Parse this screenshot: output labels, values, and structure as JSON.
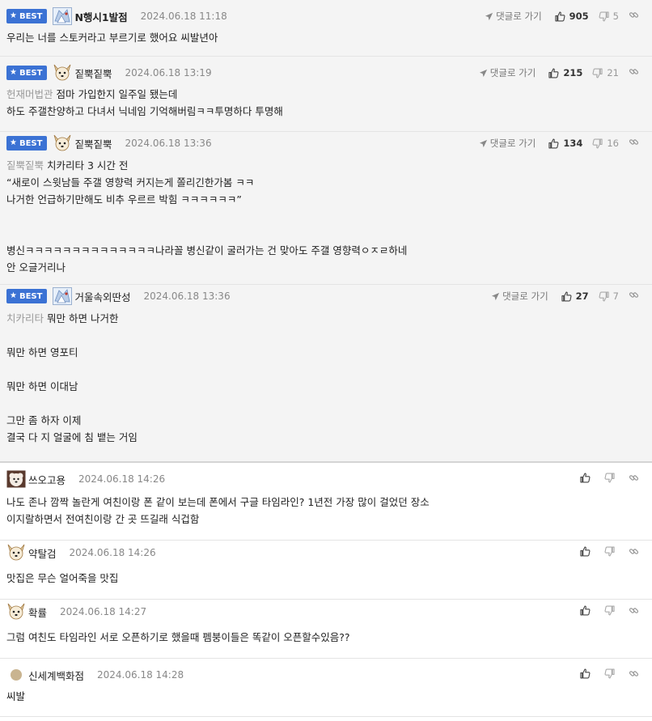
{
  "labels": {
    "best": "BEST",
    "goto_reply": "댓글로 가기"
  },
  "colors": {
    "best_badge": "#3b72d4",
    "best_bg": "#f4f4f4"
  },
  "comments": [
    {
      "best": true,
      "avatar": "ice-avatar-icon",
      "nickname": "N행시1발점",
      "bold": true,
      "date": "2024.06.18 11:18",
      "likes": "905",
      "dislikes": "5",
      "lines": [
        {
          "text": "우리는 너를 스토커라고 부르기로 했어요 씨발년아"
        }
      ]
    },
    {
      "best": true,
      "avatar": "dog-avatar-icon",
      "nickname": "짙뿍짙뿍",
      "bold": false,
      "date": "2024.06.18 13:19",
      "likes": "215",
      "dislikes": "21",
      "lines": [
        {
          "mention": "헌재머법관",
          "text": "점마 가입한지 일주일 됐는데"
        },
        {
          "text": "하도 주갤찬양하고 다녀서 닉네임 기억해버림ㅋㅋ투명하다 투명해"
        }
      ]
    },
    {
      "best": true,
      "avatar": "dog-avatar-icon",
      "nickname": "짙뿍짙뿍",
      "bold": false,
      "date": "2024.06.18 13:36",
      "likes": "134",
      "dislikes": "16",
      "lines": [
        {
          "mention": "짙뿍짙뿍",
          "text": "치카리타 3 시간 전"
        },
        {
          "text": "“새로이 스윗남들 주갤 영향력 커지는게 쫄리긴한가봄 ㅋㅋ"
        },
        {
          "text": "나거한 언급하기만해도 비추 우르르 박힘 ㅋㅋㅋㅋㅋㅋ”"
        },
        {
          "text": ""
        },
        {
          "text": ""
        },
        {
          "text": "병신ㅋㅋㅋㅋㅋㅋㅋㅋㅋㅋㅋㅋㅋㅋ나라꼴 병신같이 굴러가는 건 맞아도 주갤 영향력ㅇㅈㄹ하네"
        },
        {
          "text": "안 오글거리나"
        }
      ]
    },
    {
      "best": true,
      "avatar": "ice-avatar-icon",
      "nickname": "거울속외딴성",
      "bold": false,
      "date": "2024.06.18 13:36",
      "likes": "27",
      "dislikes": "7",
      "lines": [
        {
          "mention": "치카리타",
          "text": "뭐만 하면 나거한"
        },
        {
          "text": ""
        },
        {
          "text": "뭐만 하면 영포티"
        },
        {
          "text": ""
        },
        {
          "text": "뭐만 하면 이대남"
        },
        {
          "text": ""
        },
        {
          "text": "그만 좀 하자 이제"
        },
        {
          "text": "결국 다 지 얼굴에 침 뱉는 거임"
        }
      ]
    },
    {
      "best": false,
      "avatar": "fluffy-dog-avatar-icon",
      "nickname": "쓰오고용",
      "bold": false,
      "date": "2024.06.18 14:26",
      "lines": [
        {
          "text": "나도 존나 깜짝 놀란게 여친이랑 폰 같이 보는데 폰에서 구글 타임라인? 1년전 가장 많이 걸었던 장소"
        },
        {
          "text": "이지랄하면서 전여친이랑 간 곳 뜨길래 식겁함"
        }
      ]
    },
    {
      "best": false,
      "avatar": "dog-avatar-icon",
      "nickname": "약탈검",
      "bold": false,
      "date": "2024.06.18 14:26",
      "lines": [
        {
          "text": "맛집은 무슨 얼어죽을 맛집"
        }
      ]
    },
    {
      "best": false,
      "avatar": "dog-avatar-icon",
      "nickname": "확률",
      "bold": false,
      "date": "2024.06.18 14:27",
      "lines": [
        {
          "text": "그럼 여친도 타임라인 서로 오픈하기로 했을때 펨붕이들은 똑같이 오픈할수있음??"
        }
      ]
    },
    {
      "best": false,
      "avatar": "dot-avatar-icon",
      "nickname": "신세계백화점",
      "bold": false,
      "date": "2024.06.18 14:28",
      "lines": [
        {
          "text": "씨발"
        }
      ]
    }
  ]
}
